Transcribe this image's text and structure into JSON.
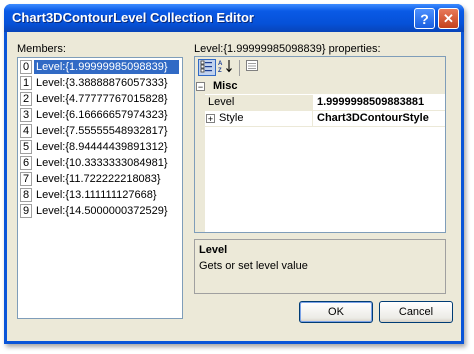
{
  "window": {
    "title": "Chart3DContourLevel Collection Editor",
    "help_label": "?",
    "close_label": "✕"
  },
  "members": {
    "label": "Members:",
    "items": [
      {
        "index": "0",
        "text": "Level:{1.99999985098839}"
      },
      {
        "index": "1",
        "text": "Level:{3.38888876057333}"
      },
      {
        "index": "2",
        "text": "Level:{4.77777767015828}"
      },
      {
        "index": "3",
        "text": "Level:{6.16666657974323}"
      },
      {
        "index": "4",
        "text": "Level:{7.55555548932817}"
      },
      {
        "index": "5",
        "text": "Level:{8.94444439891312}"
      },
      {
        "index": "6",
        "text": "Level:{10.3333333084981}"
      },
      {
        "index": "7",
        "text": "Level:{11.722222218083}"
      },
      {
        "index": "8",
        "text": "Level:{13.111111127668}"
      },
      {
        "index": "9",
        "text": "Level:{14.5000000372529}"
      }
    ],
    "selected_index": 0
  },
  "properties": {
    "label": "Level:{1.99999985098839} properties:",
    "toolbar": {
      "categorized_icon": "categorized-icon",
      "alphabetical_icon": "alphabetical-icon",
      "property_pages_icon": "property-pages-icon"
    },
    "category": {
      "expander": "⊟",
      "name": "Misc"
    },
    "rows": [
      {
        "name": "Level",
        "value": "1.9999998509883881"
      },
      {
        "expander": "+",
        "name": "Style",
        "value": "Chart3DContourStyle"
      }
    ]
  },
  "description": {
    "title": "Level",
    "text": "Gets or set level value"
  },
  "buttons": {
    "ok": "OK",
    "cancel": "Cancel"
  }
}
